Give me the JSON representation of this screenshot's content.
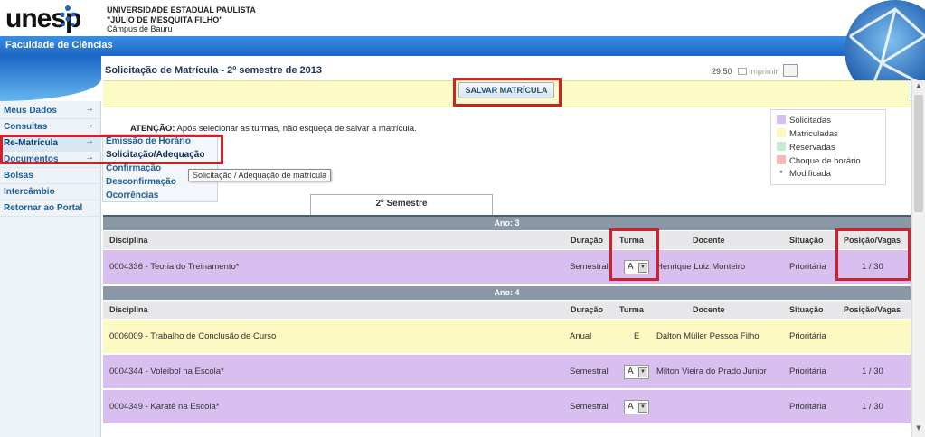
{
  "header": {
    "logo_text": "unesp",
    "university_line1": "UNIVERSIDADE ESTADUAL PAULISTA",
    "university_line2": "\"JÚLIO DE MESQUITA FILHO\"",
    "campus": "Câmpus de Bauru",
    "faculty": "Faculdade de Ciências"
  },
  "sidebar": {
    "items": [
      {
        "label": "Meus Dados",
        "arrow": "→"
      },
      {
        "label": "Consultas",
        "arrow": "→"
      },
      {
        "label": "Re-Matrícula",
        "arrow": "→"
      },
      {
        "label": "Documentos",
        "arrow": "→"
      },
      {
        "label": "Bolsas"
      },
      {
        "label": "Intercâmbio"
      },
      {
        "label": "Retornar ao Portal"
      }
    ]
  },
  "submenu": {
    "items": [
      {
        "label": "Emissão de Horário"
      },
      {
        "label": "Solicitação/Adequação"
      },
      {
        "label": "Confirmação"
      },
      {
        "label": "Desconfirmação"
      },
      {
        "label": "Ocorrências"
      }
    ],
    "tooltip": "Solicitação / Adequação de matrícula"
  },
  "main": {
    "title": "Solicitação de Matrícula - 2º semestre de 2013",
    "timer": "29:50",
    "print_label": "Imprimir",
    "save_button": "SALVAR MATRÍCULA",
    "attention_bold": "ATENÇÃO:",
    "attention_text": " Após selecionar as turmas, não esqueça de salvar a matrícula.",
    "tab": "2º Semestre"
  },
  "legend": {
    "items": [
      {
        "label": "Solicitadas",
        "color": "#d9bff0"
      },
      {
        "label": "Matriculadas",
        "color": "#fbf8c1"
      },
      {
        "label": "Reservadas",
        "color": "#c9ebc9"
      },
      {
        "label": "Choque de horário",
        "color": "#f6b8b8"
      },
      {
        "label": "Modificada",
        "marker": "*"
      }
    ]
  },
  "table": {
    "columns": {
      "disciplina": "Disciplina",
      "duracao": "Duração",
      "turma": "Turma",
      "docente": "Docente",
      "situacao": "Situação",
      "posicao": "Posição/Vagas"
    },
    "years": [
      {
        "title": "Ano: 3",
        "rows": [
          {
            "disciplina": "0004336 - Teoria do Treinamento*",
            "duracao": "Semestral",
            "turma": "A",
            "turma_select": true,
            "docente": "Henrique Luiz Monteiro",
            "situacao": "Prioritária",
            "posicao": "1 / 30",
            "color": "purple"
          }
        ]
      },
      {
        "title": "Ano: 4",
        "rows": [
          {
            "disciplina": "0006009 - Trabalho de Conclusão de Curso",
            "duracao": "Anual",
            "turma": "E",
            "turma_select": false,
            "docente": "Dalton Müller Pessoa Filho",
            "situacao": "Prioritária",
            "posicao": "",
            "color": "yellow"
          },
          {
            "disciplina": "0004344 - Voleibol na Escola*",
            "duracao": "Semestral",
            "turma": "A",
            "turma_select": true,
            "docente": "Milton Vieira do Prado Junior",
            "situacao": "Prioritária",
            "posicao": "1 / 30",
            "color": "purple"
          },
          {
            "disciplina": "0004349 - Karatê na Escola*",
            "duracao": "Semestral",
            "turma": "A",
            "turma_select": true,
            "docente": "",
            "situacao": "Prioritária",
            "posicao": "1 / 30",
            "color": "purple"
          }
        ]
      }
    ]
  }
}
